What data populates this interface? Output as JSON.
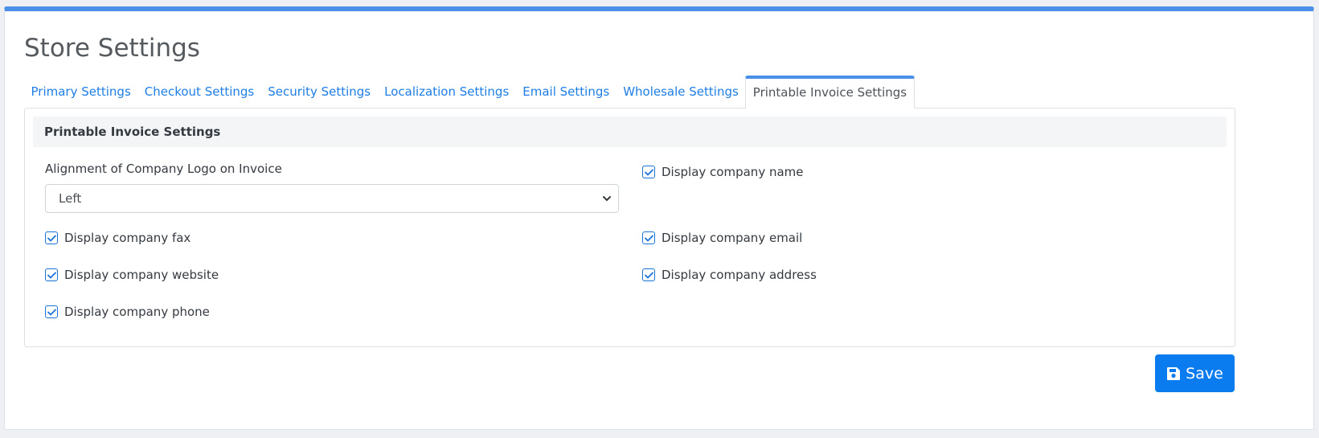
{
  "page": {
    "title": "Store Settings"
  },
  "tabs": [
    {
      "label": "Primary Settings",
      "active": false
    },
    {
      "label": "Checkout Settings",
      "active": false
    },
    {
      "label": "Security Settings",
      "active": false
    },
    {
      "label": "Localization Settings",
      "active": false
    },
    {
      "label": "Email Settings",
      "active": false
    },
    {
      "label": "Wholesale Settings",
      "active": false
    },
    {
      "label": "Printable Invoice Settings",
      "active": true
    }
  ],
  "section": {
    "title": "Printable Invoice Settings"
  },
  "logo_alignment": {
    "label": "Alignment of Company Logo on Invoice",
    "value": "Left"
  },
  "checkboxes": {
    "company_name": {
      "label": "Display company name",
      "checked": true
    },
    "company_fax": {
      "label": "Display company fax",
      "checked": true
    },
    "company_email": {
      "label": "Display company email",
      "checked": true
    },
    "company_website": {
      "label": "Display company website",
      "checked": true
    },
    "company_address": {
      "label": "Display company address",
      "checked": true
    },
    "company_phone": {
      "label": "Display company phone",
      "checked": true
    }
  },
  "actions": {
    "save_label": "Save",
    "save_icon": "floppy-disk-icon"
  },
  "colors": {
    "accent": "#4a90e8",
    "link": "#1e7ee6",
    "primary_button": "#0a7cf0",
    "checkbox": "#1a73d9"
  }
}
